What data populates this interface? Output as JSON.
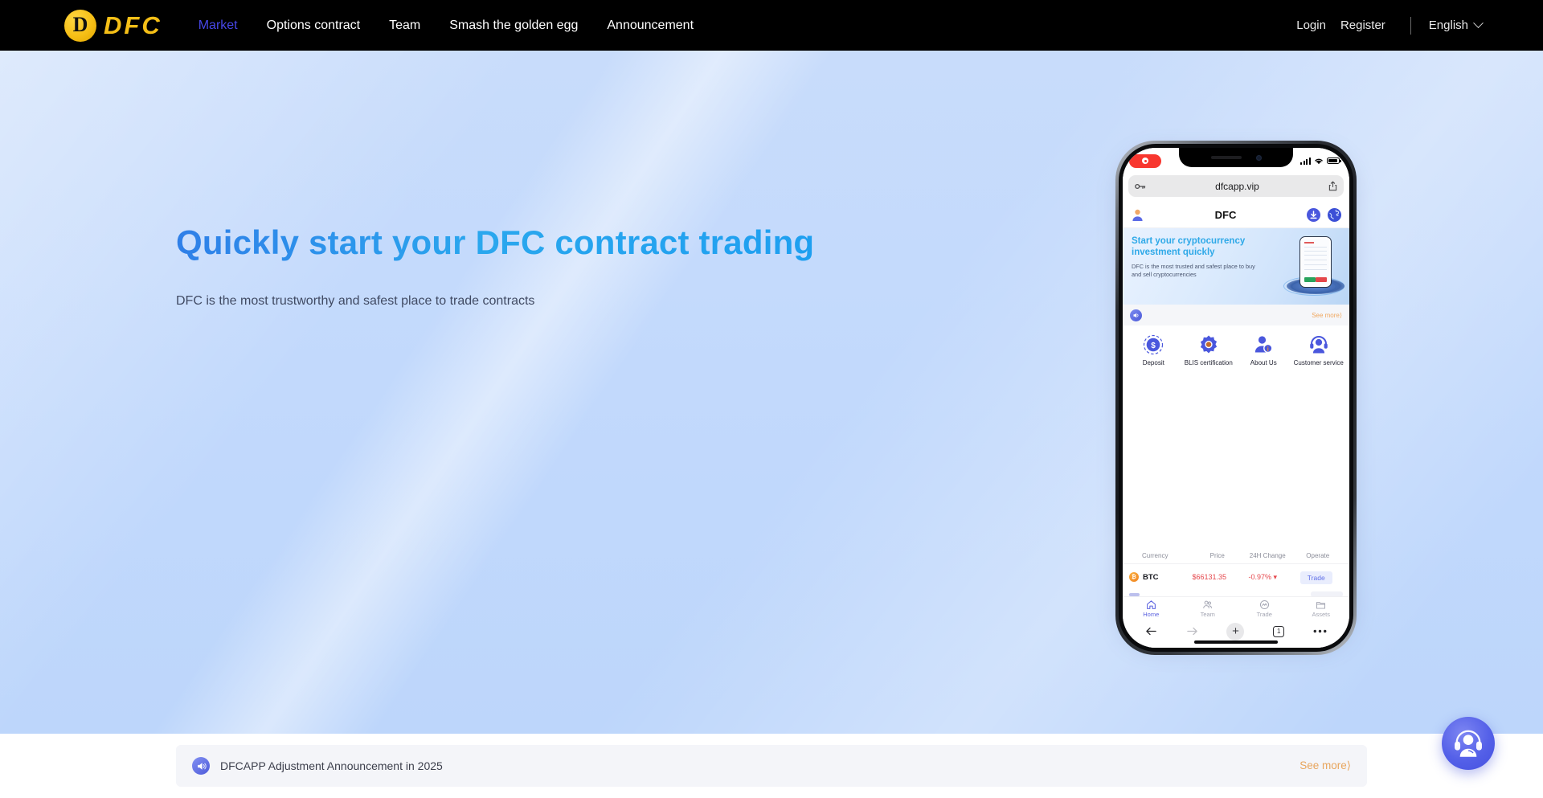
{
  "brand": {
    "logo_letter": "D",
    "logo_word": "DFC",
    "logo_color": "#f5bf17"
  },
  "nav": {
    "links": [
      {
        "label": "Market",
        "active": true
      },
      {
        "label": "Options contract",
        "active": false
      },
      {
        "label": "Team",
        "active": false
      },
      {
        "label": "Smash the golden egg",
        "active": false
      },
      {
        "label": "Announcement",
        "active": false
      }
    ],
    "login_label": "Login",
    "register_label": "Register",
    "language": "English",
    "active_color": "#4747e8"
  },
  "hero": {
    "title": "Quickly start your DFC contract trading",
    "subtitle": "DFC is the most trustworthy and safest place to trade contracts",
    "background_color": "#c3d9fb",
    "title_gradient_from": "#2f7fe8",
    "title_gradient_to": "#1e9ff0"
  },
  "phone": {
    "status": {
      "recording_indicator": "record-pill",
      "signal": "signal-bars",
      "wifi": "wifi-icon",
      "battery": "battery-icon"
    },
    "browser": {
      "url": "dfcapp.vip",
      "lock_icon": "key-icon",
      "share_icon": "share-icon"
    },
    "app_header": {
      "title": "DFC",
      "avatar_icon": "user-avatar-icon",
      "download_icon": "download-icon",
      "language_icon": "globe-icon"
    },
    "banner": {
      "title": "Start your cryptocurrency investment quickly",
      "subtitle": "DFC is the most trusted and safest place to buy and sell cryptocurrencies",
      "title_color": "#2fa9e8"
    },
    "notice": {
      "speaker_icon": "megaphone-icon",
      "see_more": "See more⟩",
      "see_more_color": "#f0a860"
    },
    "quick_actions": [
      {
        "label": "Deposit",
        "icon": "dollar-coin-icon"
      },
      {
        "label": "BLIS certification",
        "icon": "certificate-badge-icon"
      },
      {
        "label": "About Us",
        "icon": "about-person-icon"
      },
      {
        "label": "Customer service",
        "icon": "headset-icon"
      }
    ],
    "market": {
      "headers": [
        "Currency",
        "Price",
        "24H Change",
        "Operate"
      ],
      "rows": [
        {
          "symbol": "BTC",
          "price": "$66131.35",
          "change": "-0.97%",
          "change_direction": "down",
          "action": "Trade",
          "price_color": "#e5484d"
        }
      ]
    },
    "tabs": [
      {
        "label": "Home",
        "icon": "home-icon",
        "active": true
      },
      {
        "label": "Team",
        "icon": "team-icon",
        "active": false
      },
      {
        "label": "Trade",
        "icon": "trade-icon",
        "active": false
      },
      {
        "label": "Assets",
        "icon": "assets-icon",
        "active": false
      }
    ],
    "safari_toolbar": {
      "back_icon": "back-arrow-icon",
      "forward_icon": "forward-arrow-icon",
      "add_icon": "plus-icon",
      "tab_count": "1",
      "more_icon": "more-dots-icon"
    }
  },
  "announcement": {
    "icon": "megaphone-icon",
    "text": "DFCAPP Adjustment Announcement in 2025",
    "see_more": "See more⟩",
    "see_more_color": "#e8a55d"
  },
  "chat": {
    "icon": "customer-support-icon",
    "color": "#5460e8"
  }
}
